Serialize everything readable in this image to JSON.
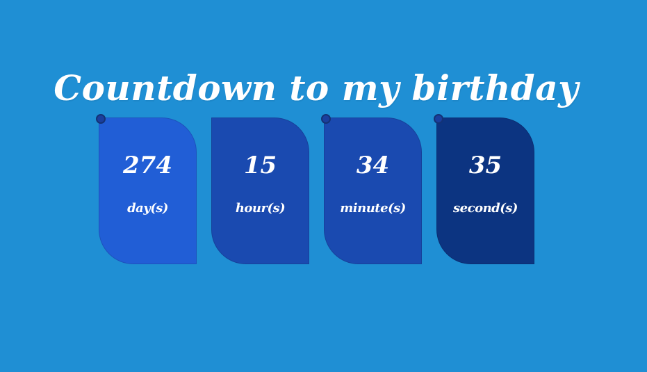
{
  "title": "Countdown to my birthday",
  "countdown": [
    {
      "value": "274",
      "unit": "day(s)"
    },
    {
      "value": "15",
      "unit": "hour(s)"
    },
    {
      "value": "34",
      "unit": "minute(s)"
    },
    {
      "value": "35",
      "unit": "second(s)"
    }
  ],
  "colors": {
    "background": "#1f8fd4",
    "card_days": "#215ed6",
    "card_hours": "#1a4ab0",
    "card_minutes": "#1a4ab0",
    "card_seconds": "#0c3481",
    "text": "#ffffff"
  }
}
